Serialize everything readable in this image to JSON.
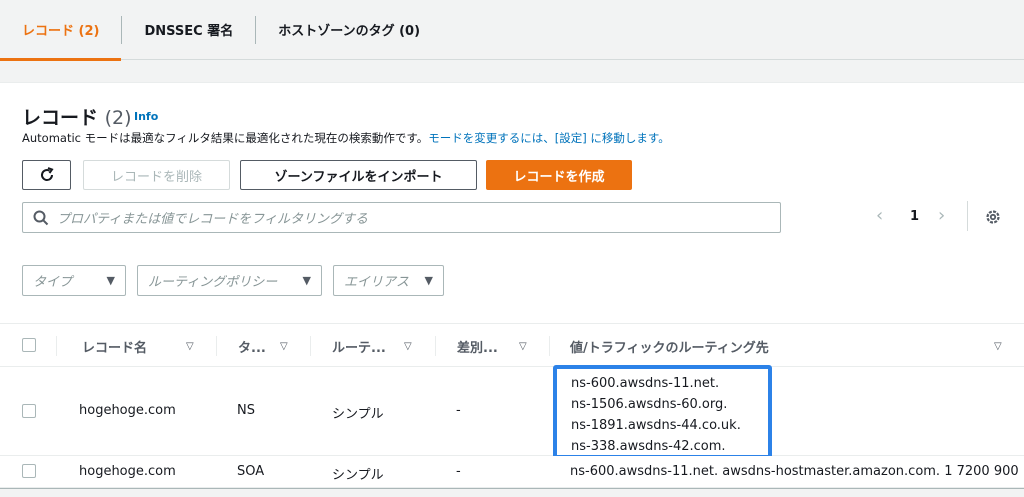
{
  "tabs": [
    {
      "label": "レコード (2)"
    },
    {
      "label": "DNSSEC 署名"
    },
    {
      "label": "ホストゾーンのタグ (0)"
    }
  ],
  "panel": {
    "title": "レコード",
    "count": "(2)",
    "info": "Info",
    "description": "Automatic モードは最適なフィルタ結果に最適化された現在の検索動作です。",
    "description_link": "モードを変更するには、[設定] に移動します。"
  },
  "toolbar": {
    "refresh_icon": "refresh-icon",
    "delete_label": "レコードを削除",
    "import_label": "ゾーンファイルをインポート",
    "create_label": "レコードを作成"
  },
  "search": {
    "placeholder": "プロパティまたは値でレコードをフィルタリングする"
  },
  "pagination": {
    "page": "1",
    "prev": "‹",
    "next": "›"
  },
  "filters": {
    "type": "タイプ",
    "routing": "ルーティングポリシー",
    "alias": "エイリアス"
  },
  "table": {
    "headers": {
      "name": "レコード名",
      "type": "タ...",
      "routing": "ルーテ...",
      "diff": "差別...",
      "value": "値/トラフィックのルーティング先"
    },
    "rows": [
      {
        "name": "hogehoge.com",
        "type": "NS",
        "routing": "シンプル",
        "diff": "-",
        "values": [
          "ns-600.awsdns-11.net.",
          "ns-1506.awsdns-60.org.",
          "ns-1891.awsdns-44.co.uk.",
          "ns-338.awsdns-42.com."
        ]
      },
      {
        "name": "hogehoge.com",
        "type": "SOA",
        "routing": "シンプル",
        "diff": "-",
        "value": "ns-600.awsdns-11.net. awsdns-hostmaster.amazon.com. 1 7200 900"
      }
    ]
  },
  "colors": {
    "accent": "#ec7211",
    "link": "#0073bb",
    "highlight": "#2c82e8"
  }
}
